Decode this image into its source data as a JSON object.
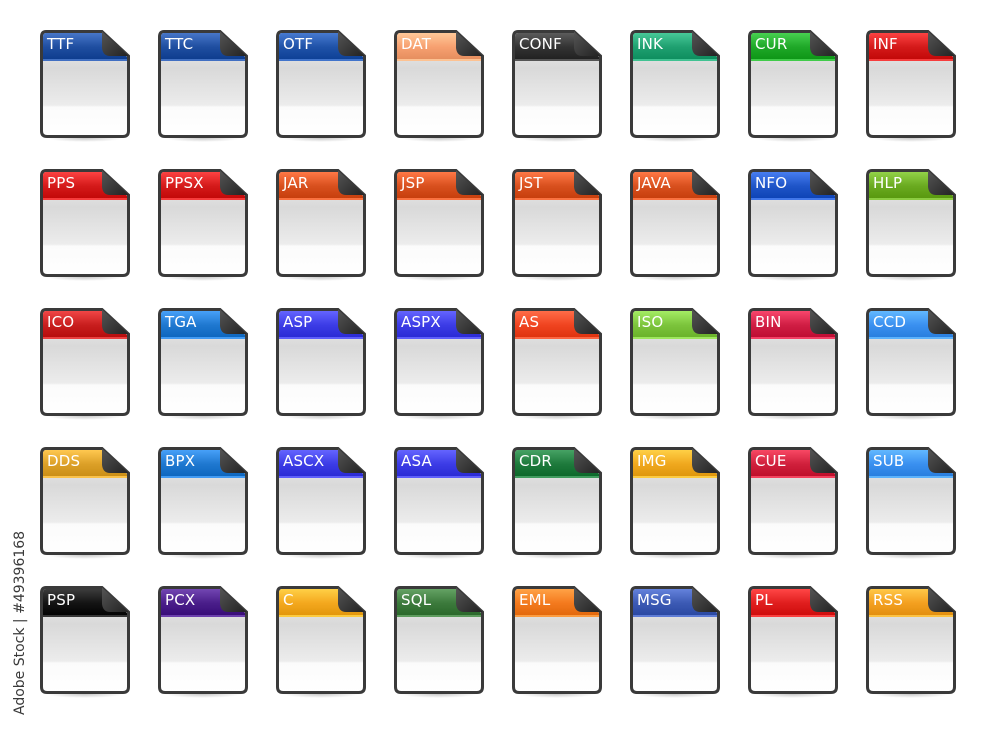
{
  "watermark": "Adobe Stock | #49396168",
  "icons": [
    {
      "label": "TTF",
      "color": "#1f4ea0"
    },
    {
      "label": "TTC",
      "color": "#1f4ea0"
    },
    {
      "label": "OTF",
      "color": "#1f52a8"
    },
    {
      "label": "DAT",
      "color": "#f7a070"
    },
    {
      "label": "CONF",
      "color": "#333333"
    },
    {
      "label": "INK",
      "color": "#1fa070"
    },
    {
      "label": "CUR",
      "color": "#1fa828"
    },
    {
      "label": "INF",
      "color": "#d41a1a"
    },
    {
      "label": "PPS",
      "color": "#d41a1a"
    },
    {
      "label": "PPSX",
      "color": "#d41a1a"
    },
    {
      "label": "JAR",
      "color": "#d8501e"
    },
    {
      "label": "JSP",
      "color": "#d8501e"
    },
    {
      "label": "JST",
      "color": "#d8501e"
    },
    {
      "label": "JAVA",
      "color": "#d8501e"
    },
    {
      "label": "NFO",
      "color": "#1f55c8"
    },
    {
      "label": "HLP",
      "color": "#6aaa20"
    },
    {
      "label": "ICO",
      "color": "#c81e1e"
    },
    {
      "label": "TGA",
      "color": "#1f78d0"
    },
    {
      "label": "ASP",
      "color": "#3c3ce6"
    },
    {
      "label": "ASPX",
      "color": "#3c3ce6"
    },
    {
      "label": "AS",
      "color": "#f04420"
    },
    {
      "label": "ISO",
      "color": "#7cc43c"
    },
    {
      "label": "BIN",
      "color": "#d01e44"
    },
    {
      "label": "CCD",
      "color": "#3a90f0"
    },
    {
      "label": "DDS",
      "color": "#dca028"
    },
    {
      "label": "BPX",
      "color": "#1f78d0"
    },
    {
      "label": "ASCX",
      "color": "#3c3ce6"
    },
    {
      "label": "ASA",
      "color": "#3c3ce6"
    },
    {
      "label": "CDR",
      "color": "#1e7a3c"
    },
    {
      "label": "IMG",
      "color": "#f0a81e"
    },
    {
      "label": "CUE",
      "color": "#d0203c"
    },
    {
      "label": "SUB",
      "color": "#3a90f0"
    },
    {
      "label": "PSP",
      "color": "#141414"
    },
    {
      "label": "PCX",
      "color": "#4a1e8a"
    },
    {
      "label": "C",
      "color": "#f4a81e"
    },
    {
      "label": "SQL",
      "color": "#3c7a3c"
    },
    {
      "label": "EML",
      "color": "#f47a1e"
    },
    {
      "label": "MSG",
      "color": "#3c5ab4"
    },
    {
      "label": "PL",
      "color": "#e01e1e"
    },
    {
      "label": "RSS",
      "color": "#f4a020"
    }
  ]
}
